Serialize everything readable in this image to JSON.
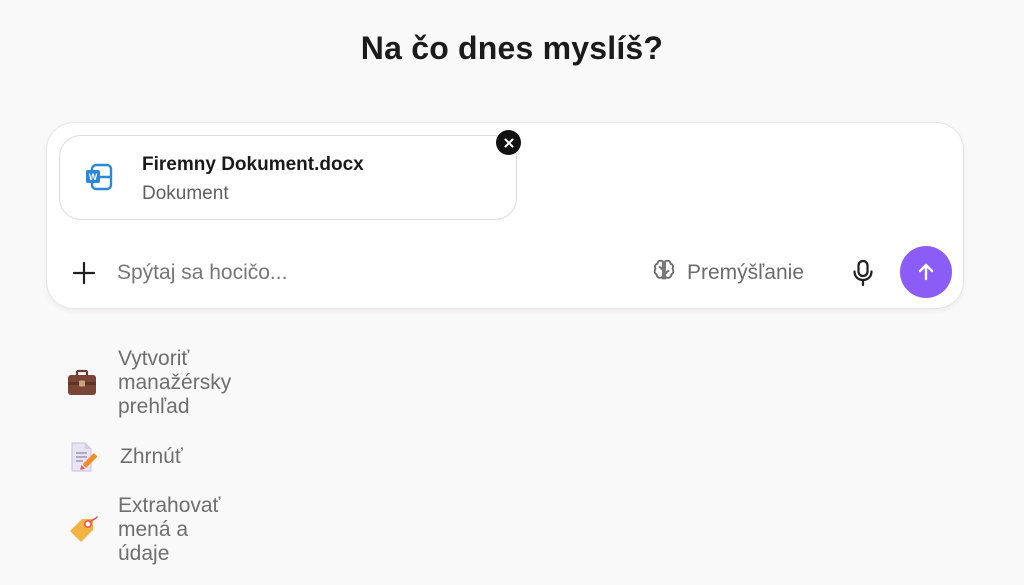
{
  "heading": "Na čo dnes myslíš?",
  "attachment": {
    "file_name": "Firemny Dokument.docx",
    "file_type": "Dokument",
    "icon": "word-doc-icon",
    "icon_color": "#2b88d8"
  },
  "composer": {
    "placeholder": "Spýtaj sa hocičo...",
    "value": "",
    "think_label": "Premýšľanie",
    "send_color": "#8b5cf6"
  },
  "suggestions": [
    {
      "label": "Vytvoriť manažérsky prehľad",
      "icon": "briefcase-icon"
    },
    {
      "label": "Zhrnúť",
      "icon": "document-pencil-icon"
    },
    {
      "label": "Extrahovať mená a údaje",
      "icon": "tag-icon"
    }
  ]
}
